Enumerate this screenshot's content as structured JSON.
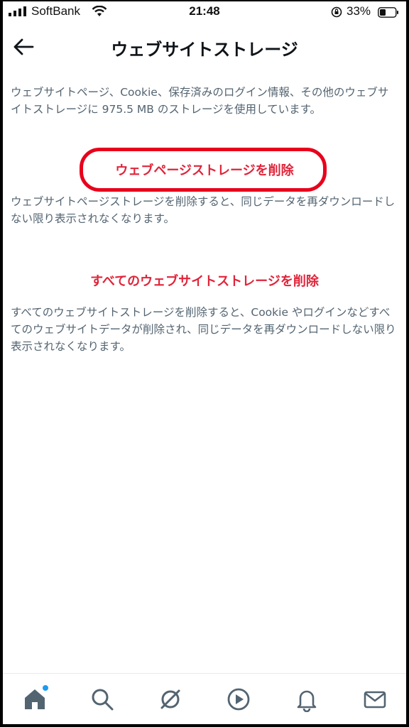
{
  "status_bar": {
    "carrier": "SoftBank",
    "time": "21:48",
    "battery": "33%"
  },
  "header": {
    "title": "ウェブサイトストレージ"
  },
  "description": "ウェブサイトページ、Cookie、保存済みのログイン情報、その他のウェブサイトストレージに 975.5 MB のストレージを使用しています。",
  "delete_page": {
    "label": "ウェブページストレージを削除",
    "note": "ウェブサイトページストレージを削除すると、同じデータを再ダウンロードしない限り表示されなくなります。"
  },
  "delete_all": {
    "label": "すべてのウェブサイトストレージを削除",
    "note": "すべてのウェブサイトストレージを削除すると、Cookie やログインなどすべてのウェブサイトデータが削除され、同じデータを再ダウンロードしない限り表示されなくなります。"
  },
  "bottom_nav": {
    "items": [
      "home-icon",
      "search-icon",
      "spaces-icon",
      "video-icon",
      "notifications-icon",
      "messages-icon"
    ]
  },
  "colors": {
    "accent_red": "#e0243a",
    "highlight_ring": "#e8001c",
    "text_secondary": "#536471",
    "notification_dot": "#1d9bf0"
  }
}
